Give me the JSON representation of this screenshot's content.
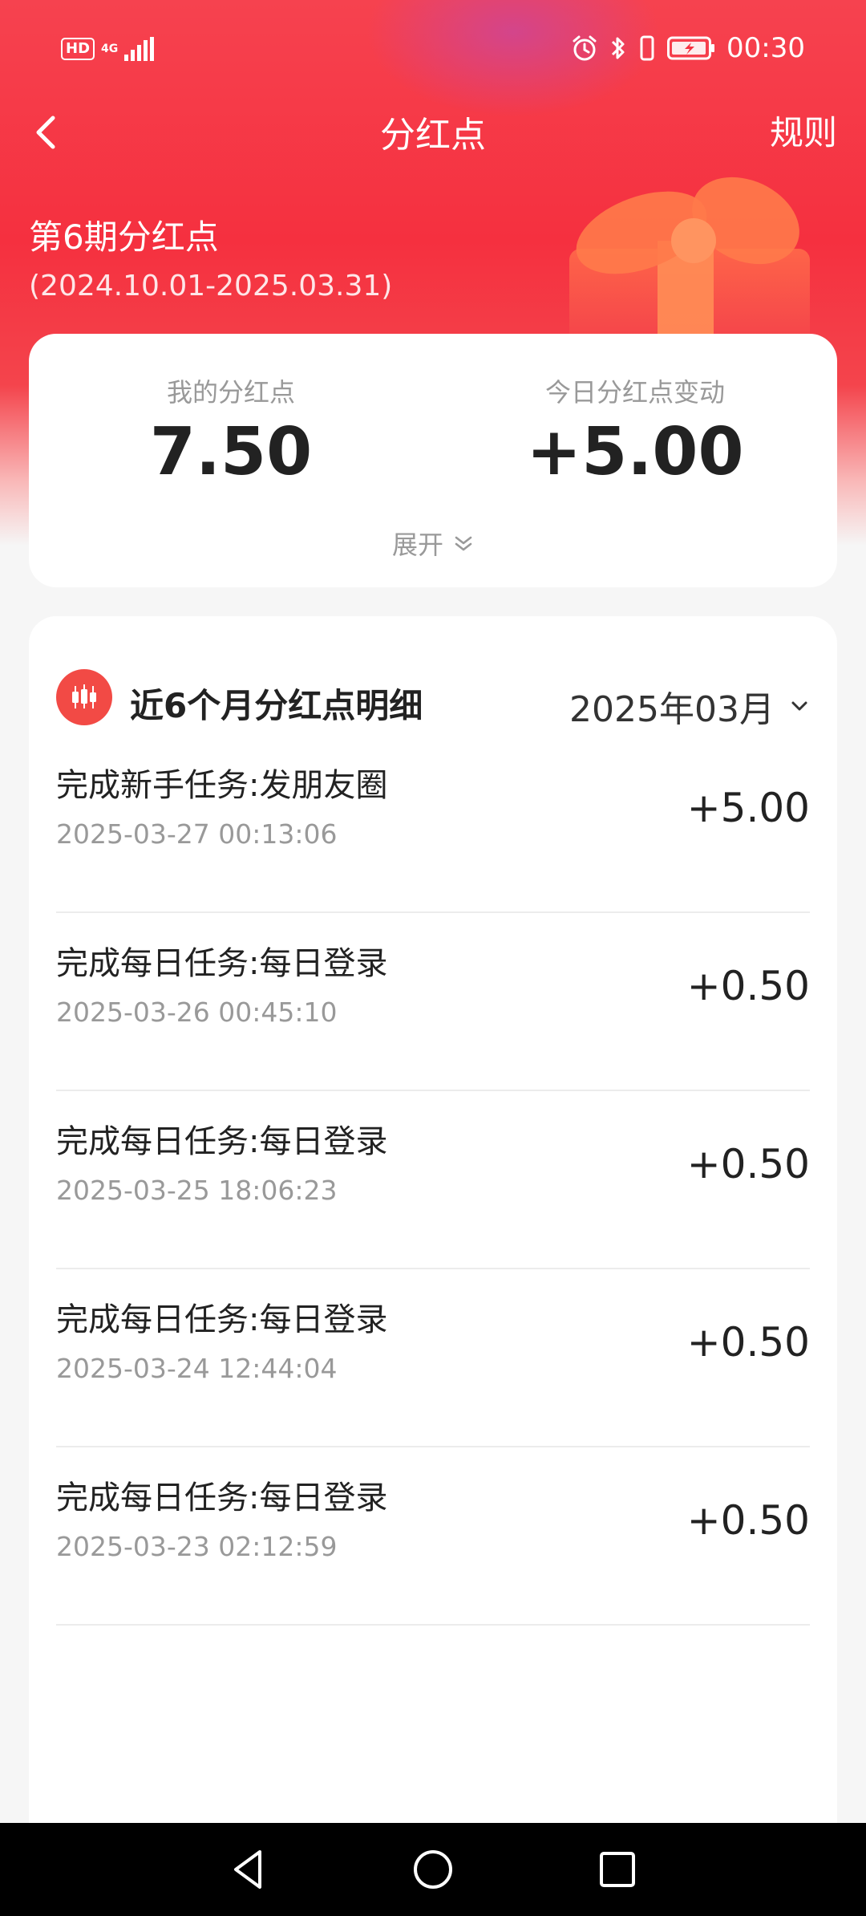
{
  "status_bar": {
    "hd": "HD",
    "network": "4G",
    "time": "00:30",
    "icons": [
      "signal-icon",
      "alarm-icon",
      "bluetooth-icon",
      "vibrate-icon",
      "battery-charging-icon"
    ]
  },
  "nav": {
    "title": "分红点",
    "rules": "规则"
  },
  "period": {
    "title": "第6期分红点",
    "range": "(2024.10.01-2025.03.31)"
  },
  "summary": {
    "my_points_label": "我的分红点",
    "my_points_value": "7.50",
    "today_change_label": "今日分红点变动",
    "today_change_value": "+5.00",
    "expand_label": "展开"
  },
  "detail": {
    "title": "近6个月分红点明细",
    "month": "2025年03月",
    "records": [
      {
        "name": "完成新手任务:发朋友圈",
        "time": "2025-03-27 00:13:06",
        "amount": "+5.00"
      },
      {
        "name": "完成每日任务:每日登录",
        "time": "2025-03-26 00:45:10",
        "amount": "+0.50"
      },
      {
        "name": "完成每日任务:每日登录",
        "time": "2025-03-25 18:06:23",
        "amount": "+0.50"
      },
      {
        "name": "完成每日任务:每日登录",
        "time": "2025-03-24 12:44:04",
        "amount": "+0.50"
      },
      {
        "name": "完成每日任务:每日登录",
        "time": "2025-03-23 02:12:59",
        "amount": "+0.50"
      }
    ]
  },
  "colors": {
    "brand_red": "#f5303f",
    "text_primary": "#222222",
    "text_secondary": "#999999"
  }
}
